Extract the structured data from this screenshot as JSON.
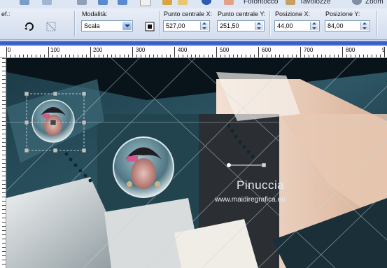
{
  "menu": {
    "left_label": "ef.:",
    "items": [
      {
        "label": "Fotoritocco"
      },
      {
        "label": "Tavolozze"
      },
      {
        "label": "Zoom"
      }
    ]
  },
  "options": {
    "mode_label": "Modalità:",
    "mode_value": "Scala",
    "center_x_label": "Punto centrale X:",
    "center_x_value": "527,00",
    "center_y_label": "Punto centrale Y:",
    "center_y_value": "251,50",
    "pos_x_label": "Posizione X:",
    "pos_x_value": "44,00",
    "pos_y_label": "Posizione Y:",
    "pos_y_value": "84,00"
  },
  "ruler": {
    "ticks": [
      "0",
      "100",
      "200",
      "300",
      "400",
      "500",
      "600",
      "700",
      "800",
      "9"
    ]
  },
  "canvas": {
    "watermark_name": "Pinuccia",
    "watermark_url": "www.maidiregrafica.eu"
  },
  "colors": {
    "accent": "#3a5fcd",
    "teal": "#2e5766",
    "peach": "#e6c2ab"
  }
}
